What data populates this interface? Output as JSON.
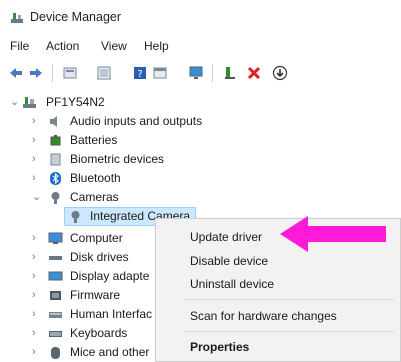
{
  "window": {
    "title": "Device Manager"
  },
  "menu": [
    "File",
    "Action",
    "View",
    "Help"
  ],
  "toolbar": [
    "back-arrow-icon",
    "forward-arrow-icon",
    "properties-grid-icon",
    "device-list-icon",
    "help-book-icon",
    "view-panel-icon",
    "monitor-icon",
    "update-driver-icon",
    "uninstall-red-x-icon",
    "download-circle-icon"
  ],
  "tree": {
    "root": "PF1Y54N2",
    "items": [
      {
        "label": "Audio inputs and outputs",
        "icon": "speaker-icon"
      },
      {
        "label": "Batteries",
        "icon": "battery-icon"
      },
      {
        "label": "Biometric devices",
        "icon": "fingerprint-icon"
      },
      {
        "label": "Bluetooth",
        "icon": "bluetooth-icon"
      },
      {
        "label": "Cameras",
        "icon": "camera-icon",
        "expanded": true
      },
      {
        "label": "Integrated Camera",
        "icon": "webcam-icon",
        "child": true,
        "selected": true
      },
      {
        "label": "Computer",
        "icon": "computer-icon"
      },
      {
        "label": "Disk drives",
        "icon": "disk-drive-icon"
      },
      {
        "label": "Display adapte",
        "icon": "display-adapter-icon"
      },
      {
        "label": "Firmware",
        "icon": "firmware-icon"
      },
      {
        "label": "Human Interfac",
        "icon": "human-interface-icon"
      },
      {
        "label": "Keyboards",
        "icon": "keyboard-icon"
      },
      {
        "label": "Mice and other",
        "icon": "mouse-icon"
      }
    ]
  },
  "context_menu": {
    "update_driver": "Update driver",
    "disable_device": "Disable device",
    "uninstall_device": "Uninstall device",
    "scan_hardware": "Scan for hardware changes",
    "properties": "Properties"
  },
  "colors": {
    "selection_bg": "#cce8ff",
    "menu_bg": "#f2f2f2",
    "arrow_magenta": "#ff1ad9"
  }
}
